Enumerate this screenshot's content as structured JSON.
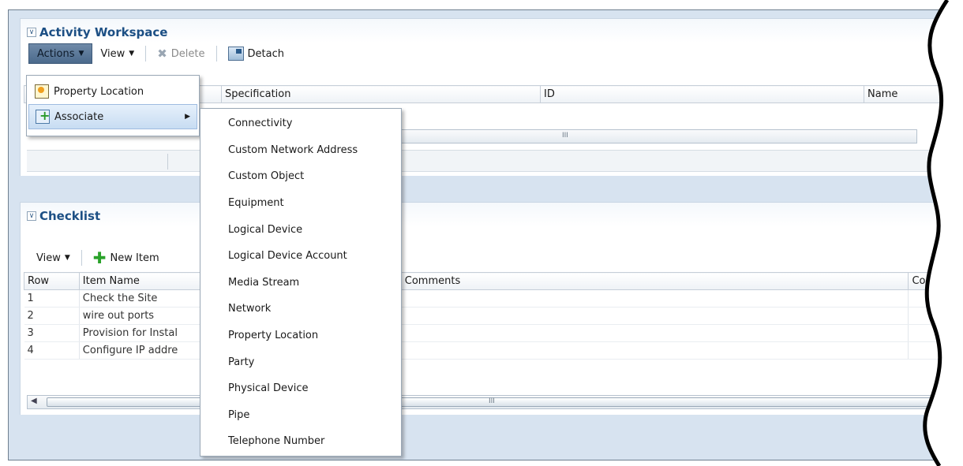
{
  "activity_workspace": {
    "title": "Activity Workspace",
    "toolbar": {
      "actions_label": "Actions",
      "view_label": "View",
      "delete_label": "Delete",
      "detach_label": "Detach"
    },
    "columns": [
      "Specification",
      "ID",
      "Name"
    ],
    "scroll_grip": "III"
  },
  "actions_menu": {
    "items": [
      {
        "label": "Property Location"
      },
      {
        "label": "Associate"
      }
    ]
  },
  "associate_submenu": {
    "items": [
      "Connectivity",
      "Custom Network Address",
      "Custom Object",
      "Equipment",
      "Logical Device",
      "Logical Device Account",
      "Media Stream",
      "Network",
      "Property Location",
      "Party",
      "Physical Device",
      "Pipe",
      "Telephone Number"
    ]
  },
  "checklist": {
    "title": "Checklist",
    "toolbar": {
      "view_label": "View",
      "new_item_label": "New Item"
    },
    "columns": [
      "Row",
      "Item Name",
      "Comments",
      "Comple"
    ],
    "rows": [
      {
        "row": "1",
        "item": "Check the Site"
      },
      {
        "row": "2",
        "item": "wire out ports"
      },
      {
        "row": "3",
        "item": "Provision for Instal"
      },
      {
        "row": "4",
        "item": "Configure IP addre"
      }
    ],
    "scroll_grip": "III"
  },
  "colors": {
    "title_blue": "#1c4f84",
    "background_blue": "#d7e3f0",
    "actions_button": "#5a7898"
  }
}
